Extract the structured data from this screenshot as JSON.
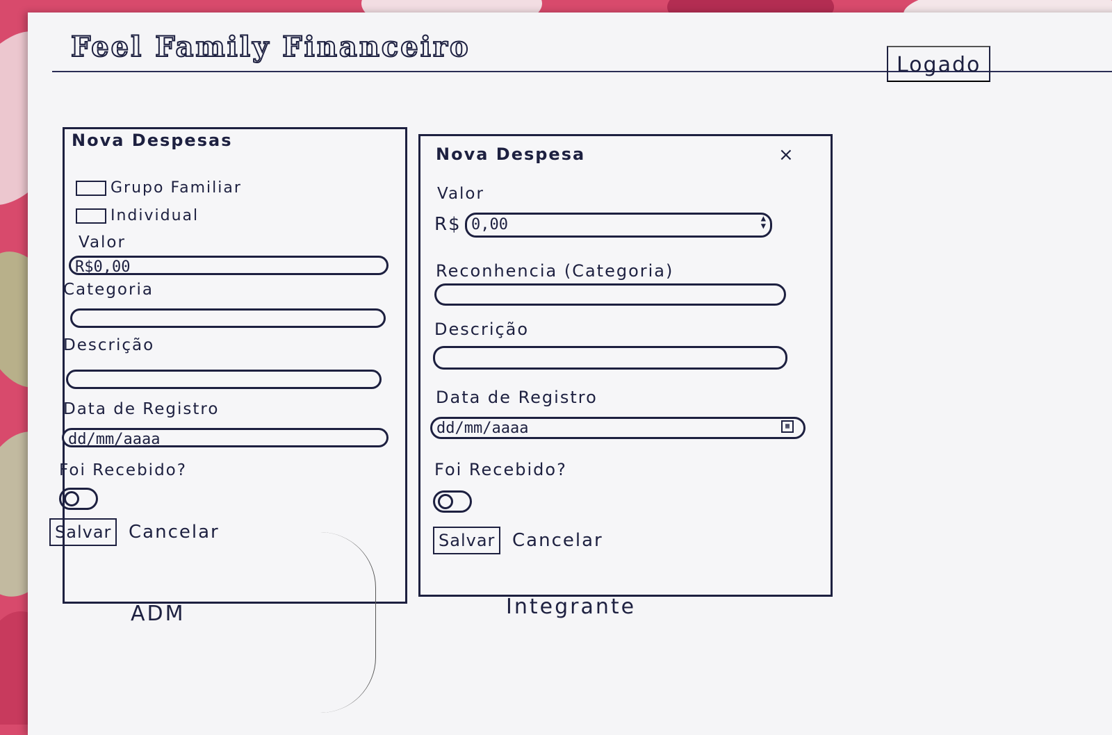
{
  "app": {
    "title": "Feel Family Financeiro"
  },
  "header": {
    "user_status": "Logado"
  },
  "adm_panel": {
    "title": "Nova Despesas",
    "options": [
      {
        "label": "Grupo Familiar"
      },
      {
        "label": "Individual"
      }
    ],
    "valor_label": "Valor",
    "valor_value": "R$0,00",
    "categoria_label": "Categoria",
    "descricao_label": "Descrição",
    "data_label": "Data de Registro",
    "data_placeholder": "dd/mm/aaaa",
    "recebido_label": "Foi Recebido?",
    "save_label": "Salvar",
    "cancel_label": "Cancelar",
    "caption": "ADM"
  },
  "integrante_panel": {
    "title": "Nova Despesa",
    "close_symbol": "×",
    "valor_label": "Valor",
    "valor_prefix": "R$",
    "valor_value": "0,00",
    "categoria_label": "Reconhencia (Categoria)",
    "descricao_label": "Descrição",
    "data_label": "Data de Registro",
    "data_placeholder": "dd/mm/aaaa",
    "recebido_label": "Foi Recebido?",
    "save_label": "Salvar",
    "cancel_label": "Cancelar",
    "caption": "Integrante"
  },
  "icons": {
    "close": "close-icon",
    "spinner": "spinner-icon",
    "calendar": "calendar-icon",
    "checkbox": "checkbox-icon",
    "toggle": "toggle-icon"
  },
  "colors": {
    "ink": "#1d2040",
    "paper": "#f5f5f7",
    "fabric": "#d84a6c"
  }
}
